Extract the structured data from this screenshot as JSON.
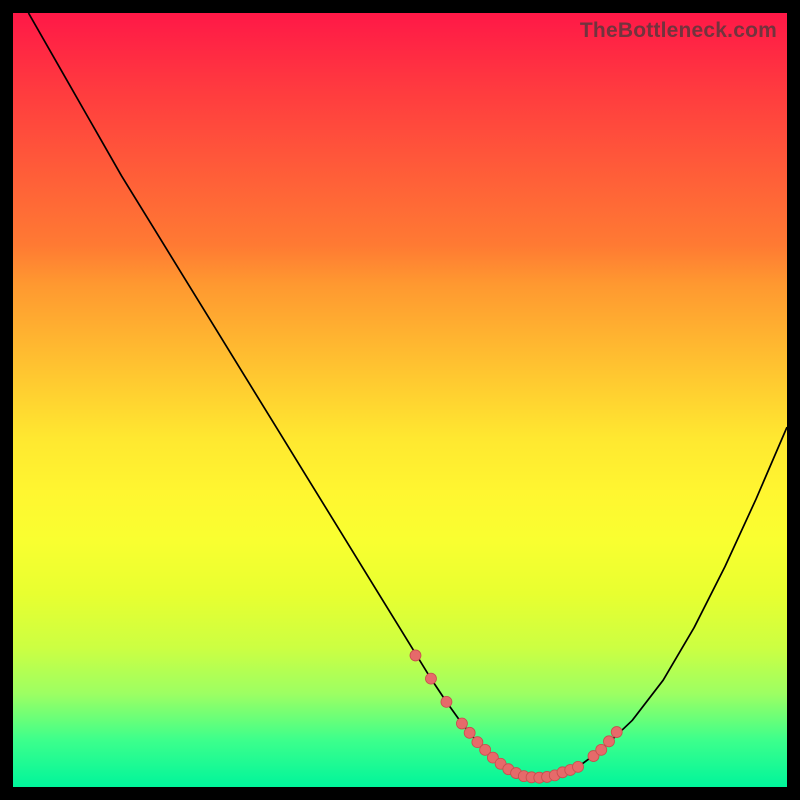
{
  "watermark": "TheBottleneck.com",
  "chart_data": {
    "type": "line",
    "title": "",
    "xlabel": "",
    "ylabel": "",
    "xlim": [
      0,
      100
    ],
    "ylim": [
      0,
      100
    ],
    "curve": {
      "x": [
        2,
        6,
        10,
        14,
        18,
        22,
        26,
        30,
        34,
        38,
        42,
        46,
        50,
        54,
        56,
        58,
        60,
        62,
        64,
        66,
        68,
        70,
        73,
        76,
        80,
        84,
        88,
        92,
        96,
        100
      ],
      "y": [
        100,
        93,
        86,
        79,
        72.5,
        66,
        59.5,
        53,
        46.5,
        40,
        33.5,
        27,
        20.5,
        14,
        11,
        8.2,
        5.8,
        3.8,
        2.3,
        1.4,
        1.2,
        1.5,
        2.6,
        4.8,
        8.6,
        13.8,
        20.6,
        28.5,
        37.2,
        46.5
      ]
    },
    "dots": {
      "x": [
        52,
        54,
        56,
        58,
        59,
        60,
        61,
        62,
        63,
        64,
        65,
        66,
        67,
        68,
        69,
        70,
        71,
        72,
        73,
        75,
        76,
        77,
        78
      ],
      "y": [
        17,
        14,
        11,
        8.2,
        7,
        5.8,
        4.8,
        3.8,
        3,
        2.3,
        1.8,
        1.4,
        1.25,
        1.2,
        1.3,
        1.5,
        1.9,
        2.2,
        2.6,
        4,
        4.8,
        5.9,
        7.1
      ]
    },
    "gradient_stops": [
      {
        "pos": 0,
        "color": "#ff1847"
      },
      {
        "pos": 50,
        "color": "#ffd430"
      },
      {
        "pos": 100,
        "color": "#00f59b"
      }
    ]
  }
}
